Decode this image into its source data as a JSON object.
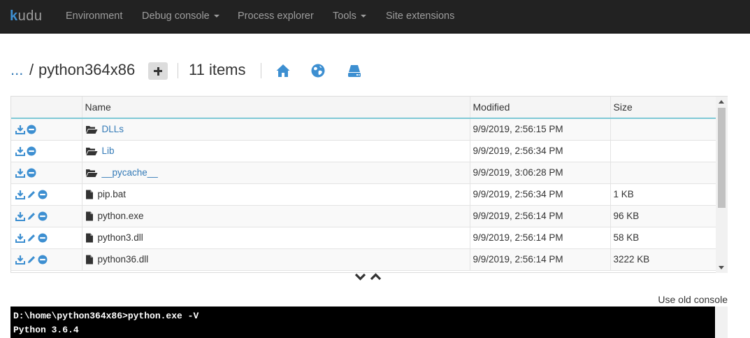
{
  "brand": {
    "name": "kudu"
  },
  "nav": {
    "items": [
      {
        "label": "Environment",
        "has_caret": false
      },
      {
        "label": "Debug console",
        "has_caret": true
      },
      {
        "label": "Process explorer",
        "has_caret": false
      },
      {
        "label": "Tools",
        "has_caret": true
      },
      {
        "label": "Site extensions",
        "has_caret": false
      }
    ]
  },
  "path": {
    "up_label": "...",
    "separator": "/",
    "current_folder": "python364x86",
    "item_count": "11 items",
    "icons": [
      "home-icon",
      "globe-icon",
      "drive-icon"
    ]
  },
  "table": {
    "columns": [
      "",
      "Name",
      "Modified",
      "Size"
    ],
    "rows": [
      {
        "name": "DLLs",
        "modified": "9/9/2019, 2:56:15 PM",
        "size": "",
        "type": "folder"
      },
      {
        "name": "Lib",
        "modified": "9/9/2019, 2:56:34 PM",
        "size": "",
        "type": "folder"
      },
      {
        "name": "__pycache__",
        "modified": "9/9/2019, 3:06:28 PM",
        "size": "",
        "type": "folder"
      },
      {
        "name": "pip.bat",
        "modified": "9/9/2019, 2:56:34 PM",
        "size": "1 KB",
        "type": "file"
      },
      {
        "name": "python.exe",
        "modified": "9/9/2019, 2:56:14 PM",
        "size": "96 KB",
        "type": "file"
      },
      {
        "name": "python3.dll",
        "modified": "9/9/2019, 2:56:14 PM",
        "size": "58 KB",
        "type": "file"
      },
      {
        "name": "python36.dll",
        "modified": "9/9/2019, 2:56:14 PM",
        "size": "3222 KB",
        "type": "file"
      }
    ]
  },
  "console": {
    "old_console_label": "Use old console",
    "lines": [
      "D:\\home\\python364x86>python.exe -V",
      "Python 3.6.4"
    ]
  },
  "colors": {
    "navbar_bg": "#222222",
    "nav_text": "#9d9d9d",
    "link": "#337ab7",
    "icon_blue": "#3d8fd1",
    "header_border": "#7fc9d6"
  }
}
